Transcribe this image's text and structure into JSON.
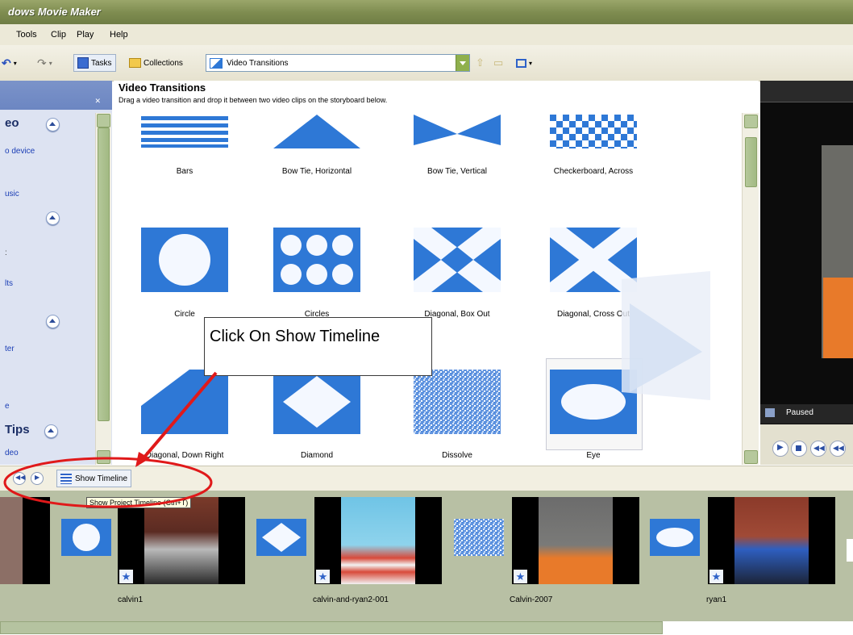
{
  "app": {
    "title": "dows Movie Maker"
  },
  "menu": [
    "Tools",
    "Clip",
    "Play",
    "Help"
  ],
  "toolbar": {
    "tasks_label": "Tasks",
    "collections_label": "Collections",
    "location_value": "Video Transitions"
  },
  "taskpane": {
    "sections": [
      {
        "title": "eo",
        "links": [
          "o device",
          "",
          "usic"
        ]
      },
      {
        "title": "",
        "links": [
          ":",
          "",
          "lts"
        ]
      },
      {
        "title": "",
        "links": [
          "ter",
          "",
          "e"
        ]
      },
      {
        "title": "Tips",
        "links": [
          "deo"
        ]
      }
    ]
  },
  "content": {
    "title": "Video Transitions",
    "subtitle": "Drag a video transition and drop it between two video clips on the storyboard below.",
    "transitions": [
      "Bars",
      "Bow Tie, Horizontal",
      "Bow Tie, Vertical",
      "Checkerboard, Across",
      "Circle",
      "Circles",
      "Diagonal, Box Out",
      "Diagonal, Cross Out",
      "Diagonal, Down Right",
      "Diamond",
      "Dissolve",
      "Eye"
    ]
  },
  "preview": {
    "status": "Paused"
  },
  "storyboard": {
    "show_timeline_label": "Show Timeline",
    "tooltip": "Show Project Timeline (Ctrl+T)",
    "clips": [
      "calvin1",
      "calvin-and-ryan2-001",
      "Calvin-2007",
      "ryan1"
    ]
  },
  "annotation": {
    "callout": "Click On Show Timeline"
  },
  "colors": {
    "accent": "#2e78d6",
    "annotation": "#e0191a",
    "titlebar": "#7d8b4f"
  }
}
